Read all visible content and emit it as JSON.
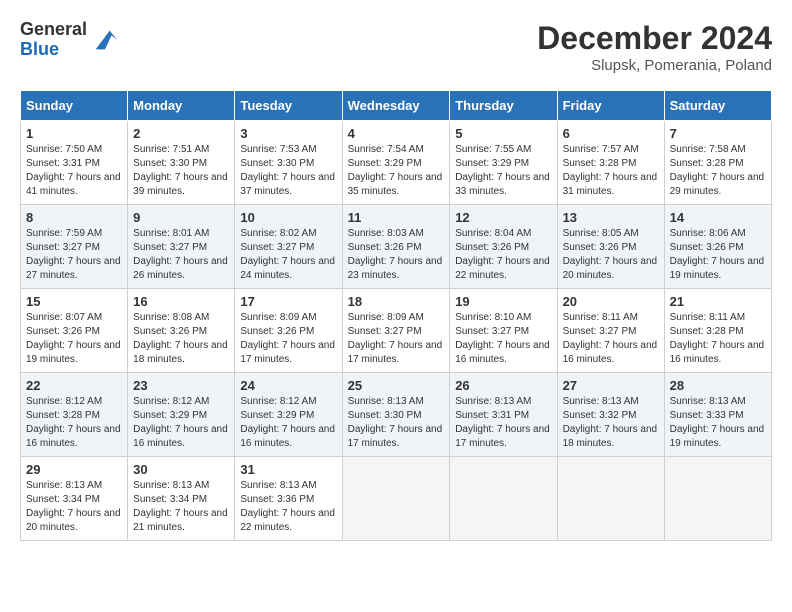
{
  "header": {
    "logo_general": "General",
    "logo_blue": "Blue",
    "title": "December 2024",
    "location": "Slupsk, Pomerania, Poland"
  },
  "weekdays": [
    "Sunday",
    "Monday",
    "Tuesday",
    "Wednesday",
    "Thursday",
    "Friday",
    "Saturday"
  ],
  "weeks": [
    [
      {
        "day": "1",
        "sunrise": "7:50 AM",
        "sunset": "3:31 PM",
        "daylight": "7 hours and 41 minutes."
      },
      {
        "day": "2",
        "sunrise": "7:51 AM",
        "sunset": "3:30 PM",
        "daylight": "7 hours and 39 minutes."
      },
      {
        "day": "3",
        "sunrise": "7:53 AM",
        "sunset": "3:30 PM",
        "daylight": "7 hours and 37 minutes."
      },
      {
        "day": "4",
        "sunrise": "7:54 AM",
        "sunset": "3:29 PM",
        "daylight": "7 hours and 35 minutes."
      },
      {
        "day": "5",
        "sunrise": "7:55 AM",
        "sunset": "3:29 PM",
        "daylight": "7 hours and 33 minutes."
      },
      {
        "day": "6",
        "sunrise": "7:57 AM",
        "sunset": "3:28 PM",
        "daylight": "7 hours and 31 minutes."
      },
      {
        "day": "7",
        "sunrise": "7:58 AM",
        "sunset": "3:28 PM",
        "daylight": "7 hours and 29 minutes."
      }
    ],
    [
      {
        "day": "8",
        "sunrise": "7:59 AM",
        "sunset": "3:27 PM",
        "daylight": "7 hours and 27 minutes."
      },
      {
        "day": "9",
        "sunrise": "8:01 AM",
        "sunset": "3:27 PM",
        "daylight": "7 hours and 26 minutes."
      },
      {
        "day": "10",
        "sunrise": "8:02 AM",
        "sunset": "3:27 PM",
        "daylight": "7 hours and 24 minutes."
      },
      {
        "day": "11",
        "sunrise": "8:03 AM",
        "sunset": "3:26 PM",
        "daylight": "7 hours and 23 minutes."
      },
      {
        "day": "12",
        "sunrise": "8:04 AM",
        "sunset": "3:26 PM",
        "daylight": "7 hours and 22 minutes."
      },
      {
        "day": "13",
        "sunrise": "8:05 AM",
        "sunset": "3:26 PM",
        "daylight": "7 hours and 20 minutes."
      },
      {
        "day": "14",
        "sunrise": "8:06 AM",
        "sunset": "3:26 PM",
        "daylight": "7 hours and 19 minutes."
      }
    ],
    [
      {
        "day": "15",
        "sunrise": "8:07 AM",
        "sunset": "3:26 PM",
        "daylight": "7 hours and 19 minutes."
      },
      {
        "day": "16",
        "sunrise": "8:08 AM",
        "sunset": "3:26 PM",
        "daylight": "7 hours and 18 minutes."
      },
      {
        "day": "17",
        "sunrise": "8:09 AM",
        "sunset": "3:26 PM",
        "daylight": "7 hours and 17 minutes."
      },
      {
        "day": "18",
        "sunrise": "8:09 AM",
        "sunset": "3:27 PM",
        "daylight": "7 hours and 17 minutes."
      },
      {
        "day": "19",
        "sunrise": "8:10 AM",
        "sunset": "3:27 PM",
        "daylight": "7 hours and 16 minutes."
      },
      {
        "day": "20",
        "sunrise": "8:11 AM",
        "sunset": "3:27 PM",
        "daylight": "7 hours and 16 minutes."
      },
      {
        "day": "21",
        "sunrise": "8:11 AM",
        "sunset": "3:28 PM",
        "daylight": "7 hours and 16 minutes."
      }
    ],
    [
      {
        "day": "22",
        "sunrise": "8:12 AM",
        "sunset": "3:28 PM",
        "daylight": "7 hours and 16 minutes."
      },
      {
        "day": "23",
        "sunrise": "8:12 AM",
        "sunset": "3:29 PM",
        "daylight": "7 hours and 16 minutes."
      },
      {
        "day": "24",
        "sunrise": "8:12 AM",
        "sunset": "3:29 PM",
        "daylight": "7 hours and 16 minutes."
      },
      {
        "day": "25",
        "sunrise": "8:13 AM",
        "sunset": "3:30 PM",
        "daylight": "7 hours and 17 minutes."
      },
      {
        "day": "26",
        "sunrise": "8:13 AM",
        "sunset": "3:31 PM",
        "daylight": "7 hours and 17 minutes."
      },
      {
        "day": "27",
        "sunrise": "8:13 AM",
        "sunset": "3:32 PM",
        "daylight": "7 hours and 18 minutes."
      },
      {
        "day": "28",
        "sunrise": "8:13 AM",
        "sunset": "3:33 PM",
        "daylight": "7 hours and 19 minutes."
      }
    ],
    [
      {
        "day": "29",
        "sunrise": "8:13 AM",
        "sunset": "3:34 PM",
        "daylight": "7 hours and 20 minutes."
      },
      {
        "day": "30",
        "sunrise": "8:13 AM",
        "sunset": "3:34 PM",
        "daylight": "7 hours and 21 minutes."
      },
      {
        "day": "31",
        "sunrise": "8:13 AM",
        "sunset": "3:36 PM",
        "daylight": "7 hours and 22 minutes."
      },
      null,
      null,
      null,
      null
    ]
  ]
}
